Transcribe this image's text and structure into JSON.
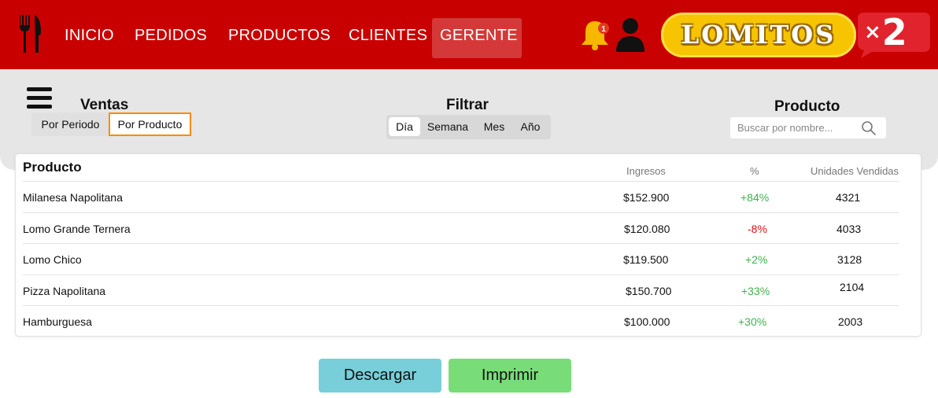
{
  "header": {
    "nav": [
      "INICIO",
      "PEDIDOS",
      "PRODUCTOS",
      "CLIENTES",
      "GERENTE"
    ],
    "active_nav": "GERENTE",
    "notification_count": "1",
    "logo_text": "LOMITOS",
    "logo_badge_prefix": "×",
    "logo_badge_number": "2",
    "colors": {
      "bar": "#c90000",
      "logo_yellow": "#f6c400",
      "bell": "#f6b800"
    }
  },
  "ventas": {
    "title": "Ventas",
    "tabs": [
      "Por Periodo",
      "Por Producto"
    ],
    "active_tab": "Por Producto"
  },
  "filtrar": {
    "title": "Filtrar",
    "options": [
      "Día",
      "Semana",
      "Mes",
      "Año"
    ],
    "active": "Día"
  },
  "producto_search": {
    "title": "Producto",
    "placeholder": "Buscar por nombre..."
  },
  "table": {
    "columns": [
      "Producto",
      "Ingresos",
      "%",
      "Unidades Vendidas"
    ],
    "rows": [
      {
        "producto": "Milanesa Napolitana",
        "ingresos": "$152.900",
        "pct": "+84%",
        "unidades": "4321"
      },
      {
        "producto": "Lomo Grande Ternera",
        "ingresos": "$120.080",
        "pct": "-8%",
        "unidades": "4033"
      },
      {
        "producto": "Lomo Chico",
        "ingresos": "$119.500",
        "pct": "+2%",
        "unidades": "3128"
      },
      {
        "producto": "Pizza Napolitana",
        "ingresos": "$150.700",
        "pct": "+33%",
        "unidades": "2104"
      },
      {
        "producto": "Hamburguesa",
        "ingresos": "$100.000",
        "pct": "+30%",
        "unidades": "2003"
      }
    ]
  },
  "actions": {
    "download": "Descargar",
    "print": "Imprimir"
  }
}
